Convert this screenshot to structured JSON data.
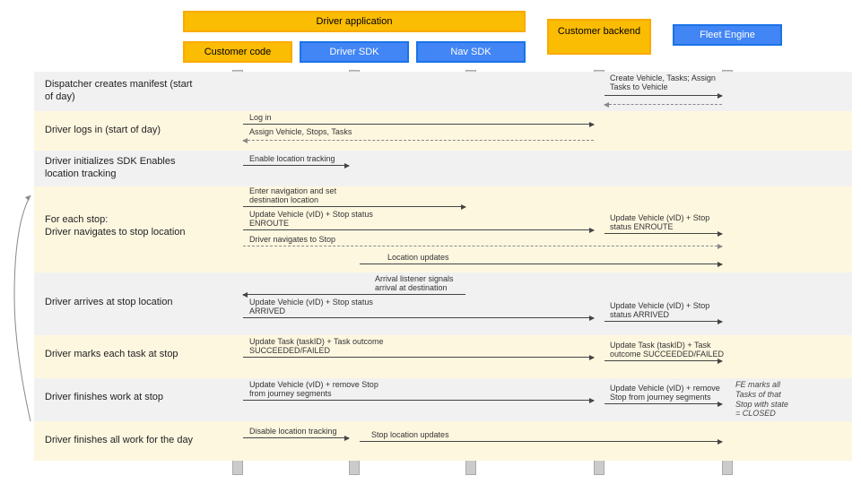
{
  "headers": {
    "driver_app": "Driver application",
    "customer_code": "Customer code",
    "driver_sdk": "Driver SDK",
    "nav_sdk": "Nav SDK",
    "customer_backend": "Customer backend",
    "fleet_engine": "Fleet Engine"
  },
  "steps": {
    "s1": "Dispatcher creates manifest (start of day)",
    "s2": "Driver logs in (start of day)",
    "s3": "Driver initializes SDK Enables location tracking",
    "s4": "For each stop:\nDriver navigates to stop location",
    "s5": "Driver arrives at stop location",
    "s6": "Driver marks each task at stop",
    "s7": "Driver finishes work at stop",
    "s8": "Driver finishes all work for the day"
  },
  "messages": {
    "m1a": "Create Vehicle, Tasks; Assign Tasks to Vehicle",
    "m2a": "Log in",
    "m2b": "Assign Vehicle, Stops, Tasks",
    "m3a": "Enable location tracking",
    "m4a": "Enter navigation and set destination location",
    "m4b": "Update Vehicle (vID) + Stop status ENROUTE",
    "m4c": "Update Vehicle (vID) + Stop status ENROUTE",
    "m4d": "Driver navigates to Stop",
    "m4e": "Location updates",
    "m5a": "Arrival listener signals arrival at destination",
    "m5b": "Update Vehicle (vID) + Stop status ARRIVED",
    "m5c": "Update Vehicle (vID) + Stop status ARRIVED",
    "m6a": "Update Task (taskID) + Task outcome SUCCEEDED/FAILED",
    "m6b": "Update Task (taskID) + Task outcome SUCCEEDED/FAILED",
    "m7a": "Update Vehicle (vID) + remove Stop from journey segments",
    "m7b": "Update Vehicle (vID) + remove Stop from journey segments",
    "m8a": "Disable location tracking",
    "m8b": "Stop location updates"
  },
  "note": "FE marks all Tasks of that Stop with state = CLOSED",
  "colors": {
    "orange": "#fbbc04",
    "blue": "#4285f4"
  }
}
